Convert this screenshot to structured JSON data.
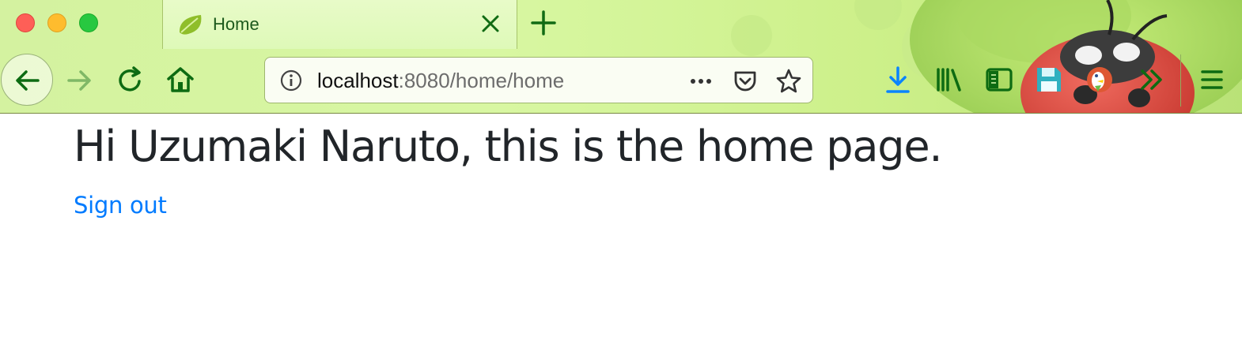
{
  "window": {
    "traffic_lights": [
      "close",
      "minimize",
      "zoom"
    ]
  },
  "tab": {
    "title": "Home",
    "favicon": "spring-leaf-icon"
  },
  "navigation": {
    "buttons": [
      "back-arrow-icon",
      "forward-arrow-icon",
      "reload-icon",
      "home-icon"
    ],
    "url_host": "localhost",
    "url_path": ":8080/home/home",
    "url_actions": [
      "page-actions-icon",
      "pocket-icon",
      "bookmark-star-icon"
    ]
  },
  "toolbar": {
    "icons": [
      "download-icon",
      "library-icon",
      "sidebar-icon",
      "save-icon",
      "duckduckgo-icon",
      "overflow-chevron-icon",
      "hamburger-menu-icon"
    ]
  },
  "page": {
    "heading": "Hi Uzumaki Naruto, this is the home page.",
    "signout_label": "Sign out"
  },
  "colors": {
    "chrome_green": "#d8f7a2",
    "icon_green": "#0d6b12",
    "heading": "#212529",
    "link": "#007bff"
  }
}
